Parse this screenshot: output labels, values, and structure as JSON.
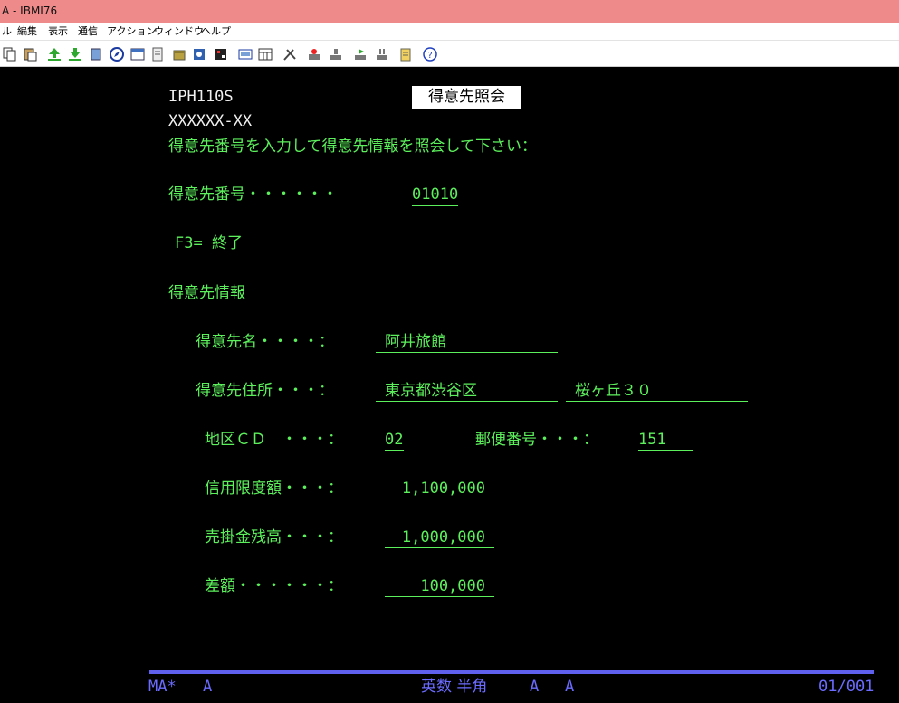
{
  "window": {
    "title": "A - IBMI76"
  },
  "menu": [
    "ル",
    "編集",
    "表示",
    "通信",
    "アクション",
    "ウィンドウ",
    "ヘルプ"
  ],
  "toolbar_icons": [
    "copy-icon",
    "paste-icon",
    "send-file-icon",
    "receive-file-icon",
    "print-screen-icon",
    "compass-icon",
    "display-icon",
    "notes-icon",
    "package-icon",
    "macro-icon",
    "record-macro-icon",
    "keyboard-icon",
    "calendar-icon",
    "tools-icon",
    "stop-macro-icon",
    "pause-icon",
    "play-macro-icon",
    "queue-icon",
    "clipboard-icon",
    "help-icon"
  ],
  "screen": {
    "program_id": "IPH110S",
    "screen_title": "得意先照会",
    "user_field": "XXXXXX-XX",
    "instruction": "得意先番号を入力して得意先情報を照会して下さい：",
    "customer_number_label": "得意先番号・・・・・・",
    "customer_number_value": "01010",
    "function_key_f3": "F3= 終了",
    "section_header": "得意先情報",
    "name_label": "得意先名・・・・：",
    "name_value": "阿井旅館",
    "address_label": "得意先住所・・・：",
    "address_value_1": "東京都渋谷区",
    "address_value_2": "桜ヶ丘３０",
    "district_label": "地区ＣＤ　・・・：",
    "district_value": "02",
    "postal_label": "郵便番号・・・：",
    "postal_value": "151",
    "credit_limit_label": "信用限度額・・・：",
    "credit_limit_value": "1,100,000",
    "receivable_label": "売掛金残高・・・：",
    "receivable_value": "1,000,000",
    "difference_label": "差額・・・・・・：",
    "difference_value": "100,000"
  },
  "status_line": {
    "session_indicator": "MA*",
    "session_type": "A",
    "input_mode": "英数 半角",
    "indicator_1": "A",
    "indicator_2": "A",
    "page": "01/001"
  },
  "colors": {
    "titlebar": "#ee8a8a",
    "screen_background": "#000000",
    "field_text": "#5cf05c",
    "protected_text": "#f0f0f0",
    "status_text": "#6b6bff",
    "status_line": "#6060ee"
  }
}
